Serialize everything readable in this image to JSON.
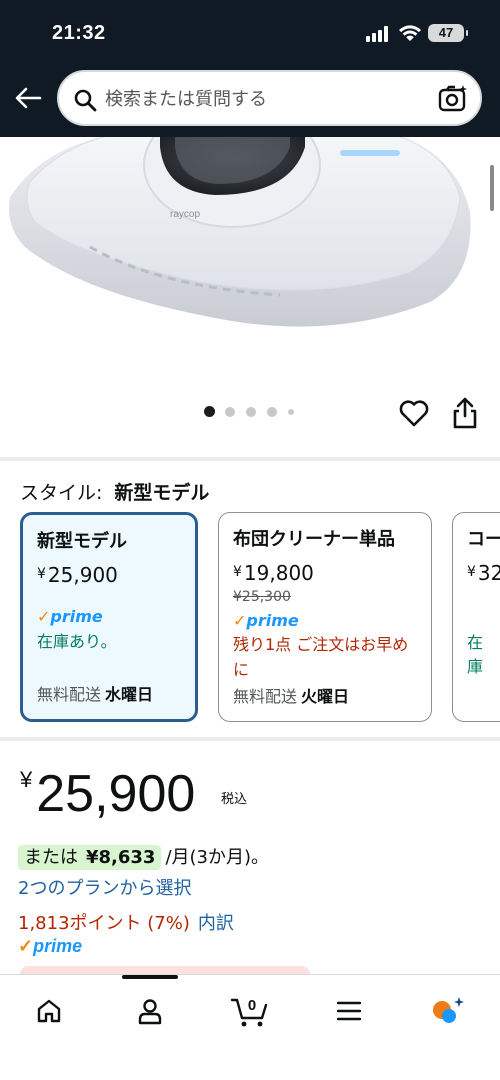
{
  "status_bar": {
    "time": "21:32",
    "battery": "47"
  },
  "search": {
    "placeholder": "検索または質問する"
  },
  "carousel": {
    "count": 5,
    "active": 0
  },
  "style": {
    "label": "スタイル:",
    "selected": "新型モデル",
    "options": [
      {
        "name": "新型モデル",
        "price": "25,900",
        "old_price": "",
        "prime": "prime",
        "stock": "在庫あり。",
        "ship_label": "無料配送",
        "ship_day": "水曜日"
      },
      {
        "name": "布団クリーナー単品",
        "price": "19,800",
        "old_price": "¥25,300",
        "prime": "prime",
        "stock": "残り1点 ご注文はお早めに",
        "ship_label": "無料配送",
        "ship_day": "火曜日"
      },
      {
        "name": "コー",
        "price": "32",
        "prime": "",
        "stock": "在庫"
      }
    ]
  },
  "price": {
    "yen": "¥",
    "amount": "25,900",
    "tax_label": "税込",
    "installment_prefix": "または",
    "installment_amount": "¥8,633",
    "installment_suffix": "/月(3か月)。",
    "plans_link": "2つのプランから選択",
    "points": "1,813ポイント (7%)",
    "points_link": "内訳",
    "prime": "prime"
  },
  "colors": {
    "selected_border": "#2b5e8f",
    "selected_bg": "#edf8ff",
    "prime_blue": "#1a98ff",
    "stock_green": "#067d62",
    "alert_red": "#b12704",
    "link_blue": "#2162a1"
  },
  "nav": {
    "items": [
      {
        "icon": "home-icon"
      },
      {
        "icon": "account-icon"
      },
      {
        "icon": "cart-icon",
        "count": "0"
      },
      {
        "icon": "menu-icon"
      },
      {
        "icon": "rufus-assistant-icon"
      }
    ]
  }
}
